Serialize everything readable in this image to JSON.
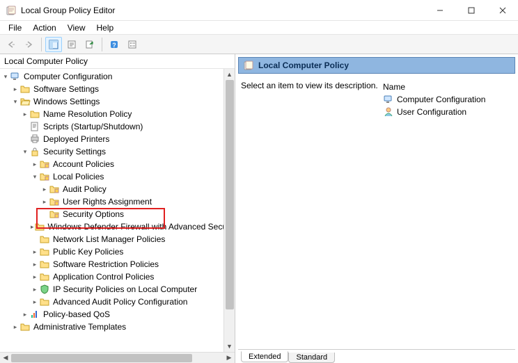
{
  "window": {
    "title": "Local Group Policy Editor"
  },
  "menubar": {
    "file": "File",
    "action": "Action",
    "view": "View",
    "help": "Help"
  },
  "tree": {
    "root": "Local Computer Policy",
    "items": {
      "computer_configuration": "Computer Configuration",
      "software_settings": "Software Settings",
      "windows_settings": "Windows Settings",
      "name_resolution_policy": "Name Resolution Policy",
      "scripts": "Scripts (Startup/Shutdown)",
      "deployed_printers": "Deployed Printers",
      "security_settings": "Security Settings",
      "account_policies": "Account Policies",
      "local_policies": "Local Policies",
      "audit_policy": "Audit Policy",
      "user_rights_assignment": "User Rights Assignment",
      "security_options": "Security Options",
      "windows_defender_firewall": "Windows Defender Firewall with Advanced Security",
      "network_list_manager_policies": "Network List Manager Policies",
      "public_key_policies": "Public Key Policies",
      "software_restriction_policies": "Software Restriction Policies",
      "application_control_policies": "Application Control Policies",
      "ip_security_policies": "IP Security Policies on Local Computer",
      "advanced_audit_policy": "Advanced Audit Policy Configuration",
      "policy_based_qos": "Policy-based QoS",
      "administrative_templates": "Administrative Templates"
    }
  },
  "rightpane": {
    "header": "Local Computer Policy",
    "description": "Select an item to view its description.",
    "column_name": "Name",
    "items": {
      "computer_configuration": "Computer Configuration",
      "user_configuration": "User Configuration"
    }
  },
  "tabs": {
    "extended": "Extended",
    "standard": "Standard"
  }
}
